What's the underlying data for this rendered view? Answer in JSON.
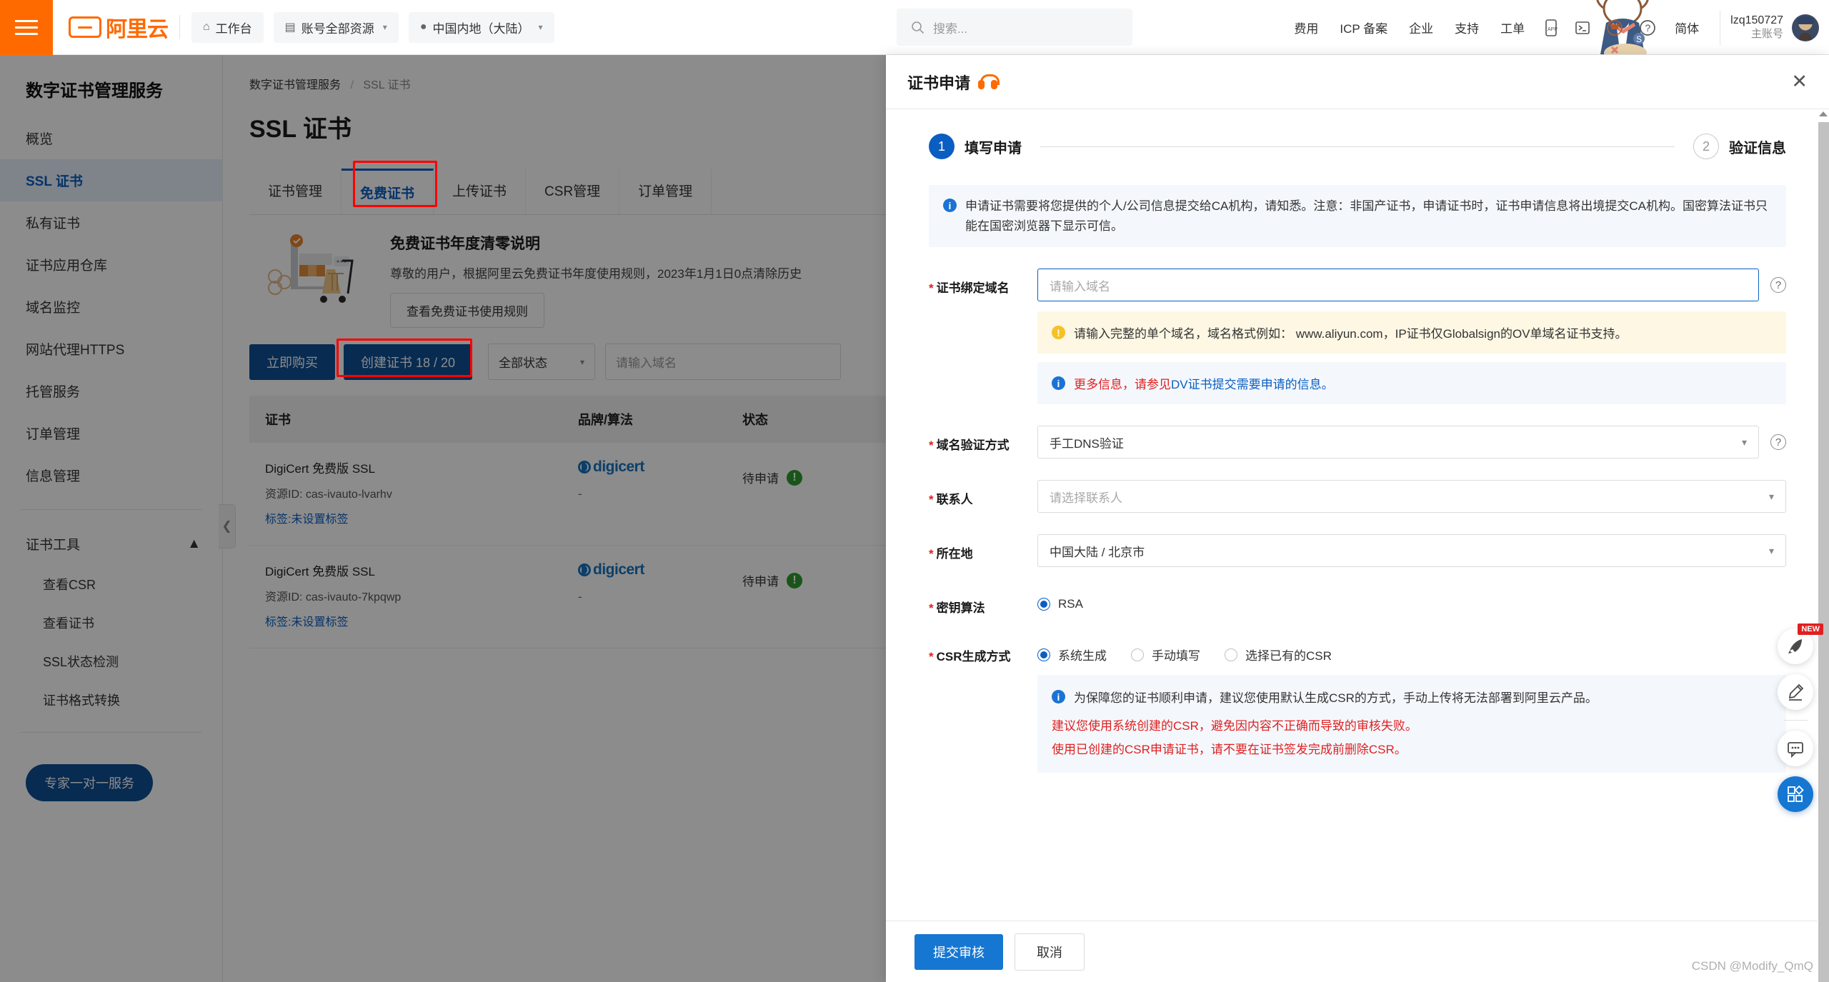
{
  "header": {
    "menu_icon": "hamburger-icon",
    "logo_text": "阿里云",
    "workbench": "工作台",
    "resources": "账号全部资源",
    "region": "中国内地（大陆）",
    "search_placeholder": "搜索...",
    "links": [
      "费用",
      "ICP 备案",
      "企业",
      "支持",
      "工单"
    ],
    "lang": "简体",
    "user_id": "lzq150727",
    "user_role": "主账号"
  },
  "sidebar": {
    "title": "数字证书管理服务",
    "items": [
      {
        "label": "概览",
        "active": false
      },
      {
        "label": "SSL 证书",
        "active": true
      },
      {
        "label": "私有证书",
        "active": false
      },
      {
        "label": "证书应用仓库",
        "active": false
      },
      {
        "label": "域名监控",
        "active": false
      },
      {
        "label": "网站代理HTTPS",
        "active": false
      },
      {
        "label": "托管服务",
        "active": false
      },
      {
        "label": "订单管理",
        "active": false
      },
      {
        "label": "信息管理",
        "active": false
      }
    ],
    "group_label": "证书工具",
    "sub_items": [
      "查看CSR",
      "查看证书",
      "SSL状态检测",
      "证书格式转换"
    ],
    "cta": "专家一对一服务"
  },
  "main": {
    "breadcrumb_root": "数字证书管理服务",
    "breadcrumb_current": "SSL 证书",
    "page_title": "SSL 证书",
    "tabs": [
      {
        "label": "证书管理",
        "active": false
      },
      {
        "label": "免费证书",
        "active": true
      },
      {
        "label": "上传证书",
        "active": false
      },
      {
        "label": "CSR管理",
        "active": false
      },
      {
        "label": "订单管理",
        "active": false
      }
    ],
    "promo_title": "免费证书年度清零说明",
    "promo_text": "尊敬的用户，根据阿里云免费证书年度使用规则，2023年1月1日0点清除历史",
    "promo_button": "查看免费证书使用规则",
    "buy_button": "立即购买",
    "create_button": "创建证书 18 / 20",
    "status_filter": "全部状态",
    "domain_search_placeholder": "请输入域名",
    "table_headers": [
      "证书",
      "品牌/算法",
      "状态"
    ],
    "rows": [
      {
        "name": "DigiCert 免费版 SSL",
        "resource_id": "资源ID: cas-ivauto-lvarhv",
        "tag": "标签:未设置标签",
        "brand": "digicert",
        "algorithm": "-",
        "status": "待申请"
      },
      {
        "name": "DigiCert 免费版 SSL",
        "resource_id": "资源ID: cas-ivauto-7kpqwp",
        "tag": "标签:未设置标签",
        "brand": "digicert",
        "algorithm": "-",
        "status": "待申请"
      }
    ]
  },
  "drawer": {
    "title": "证书申请",
    "title_icon": "headset-icon",
    "close_icon": "close-icon",
    "steps": [
      {
        "num": "1",
        "label": "填写申请",
        "active": true
      },
      {
        "num": "2",
        "label": "验证信息",
        "active": false
      }
    ],
    "notice": "申请证书需要将您提供的个人/公司信息提交给CA机构，请知悉。注意：非国产证书，申请证书时，证书申请信息将出境提交CA机构。国密算法证书只能在国密浏览器下显示可信。",
    "fields": {
      "domain": {
        "label": "证书绑定域名",
        "placeholder": "请输入域名",
        "value": "",
        "warning": "请输入完整的单个域名，域名格式例如： www.aliyun.com，IP证书仅Globalsign的OV单域名证书支持。",
        "info_prefix": "更多信息，请参见",
        "info_link": "DV证书提交需要申请的信息。"
      },
      "validation": {
        "label": "域名验证方式",
        "value": "手工DNS验证"
      },
      "contact": {
        "label": "联系人",
        "placeholder": "请选择联系人",
        "value": ""
      },
      "location": {
        "label": "所在地",
        "value": "中国大陆 / 北京市"
      },
      "key_algorithm": {
        "label": "密钥算法",
        "options": [
          {
            "label": "RSA",
            "selected": true
          }
        ]
      },
      "csr_mode": {
        "label": "CSR生成方式",
        "options": [
          {
            "label": "系统生成",
            "selected": true
          },
          {
            "label": "手动填写",
            "selected": false
          },
          {
            "label": "选择已有的CSR",
            "selected": false
          }
        ],
        "info": "为保障您的证书顺利申请，建议您使用默认生成CSR的方式，手动上传将无法部署到阿里云产品。",
        "red_line_1": "建议您使用系统创建的CSR，避免因内容不正确而导致的审核失败。",
        "red_line_2": "使用已创建的CSR申请证书，请不要在证书签发完成前删除CSR。"
      }
    },
    "submit_button": "提交审核",
    "cancel_button": "取消"
  },
  "rail": {
    "new_badge": "NEW",
    "buttons": [
      "rocket-icon",
      "pencil-icon",
      "feedback-icon",
      "apps-icon"
    ]
  },
  "watermark": "CSDN @Modify_QmQ",
  "colors": {
    "brand_orange": "#ff6a00",
    "primary_blue": "#0a5ec2",
    "deep_blue": "#0d4f94",
    "annotation_red": "#ff0000",
    "status_green": "#2e9b2e"
  }
}
